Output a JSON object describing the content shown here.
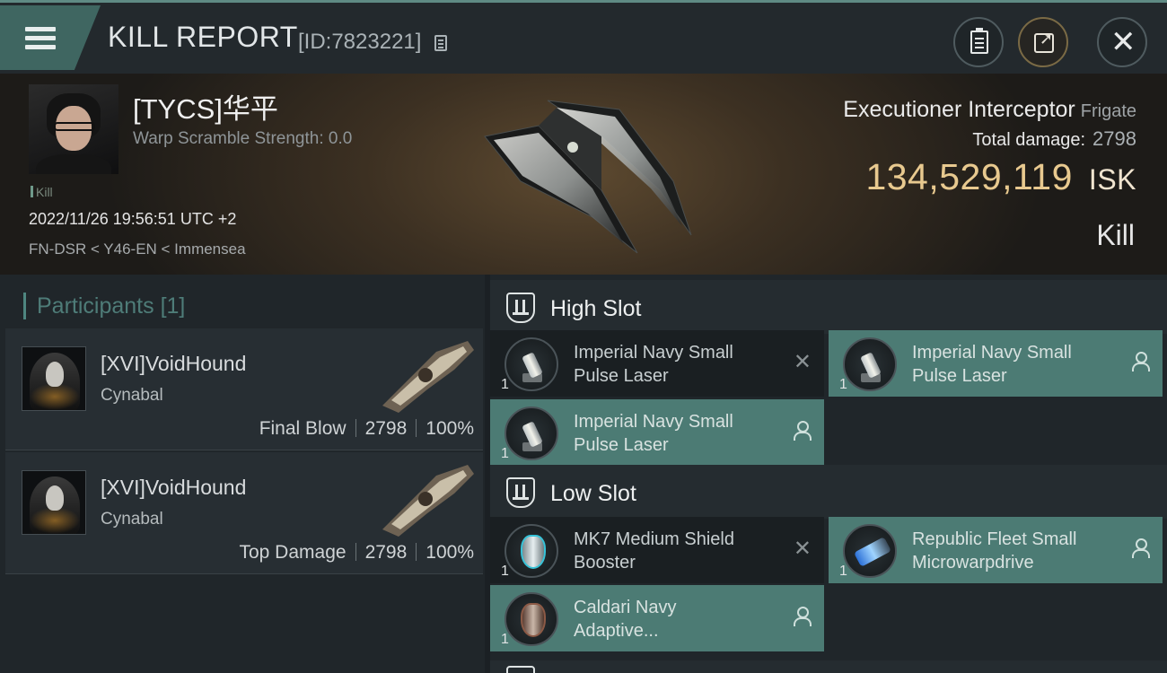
{
  "header": {
    "title": "KILL REPORT",
    "report_id": "[ID:7823221]",
    "icons": {
      "menu": "hamburger-menu-icon",
      "copy_id": "copy-icon",
      "clipboard": "clipboard-icon",
      "share": "share-icon",
      "close": "close-icon"
    }
  },
  "victim": {
    "name": "[TYCS]华平",
    "warp_scramble": "Warp Scramble Strength: 0.0",
    "kill_tag": "Kill",
    "time": "2022/11/26 19:56:51 UTC +2",
    "location": "FN-DSR < Y46-EN < Immensea",
    "ship_name": "Executioner Interceptor",
    "ship_class": "Frigate",
    "total_damage_label": "Total damage:",
    "total_damage": "2798",
    "isk_value": "134,529,119",
    "isk_unit": "ISK",
    "result": "Kill"
  },
  "participants": {
    "title": "Participants",
    "count": "[1]",
    "items": [
      {
        "name": "[XVI]VoidHound",
        "ship": "Cynabal",
        "role": "Final Blow",
        "damage": "2798",
        "percent": "100%"
      },
      {
        "name": "[XVI]VoidHound",
        "ship": "Cynabal",
        "role": "Top Damage",
        "damage": "2798",
        "percent": "100%"
      }
    ]
  },
  "fitting": {
    "high_slot": {
      "title": "High Slot",
      "modules": [
        {
          "name": "Imperial Navy Small Pulse Laser",
          "qty": "1",
          "state": "destroyed"
        },
        {
          "name": "Imperial Navy Small Pulse Laser",
          "qty": "1",
          "state": "dropped"
        },
        {
          "name": "Imperial Navy Small Pulse Laser",
          "qty": "1",
          "state": "dropped"
        }
      ]
    },
    "low_slot": {
      "title": "Low Slot",
      "modules": [
        {
          "name": "MK7 Medium Shield Booster",
          "qty": "1",
          "state": "destroyed"
        },
        {
          "name": "Republic Fleet Small Microwarpdrive",
          "qty": "1",
          "state": "dropped"
        },
        {
          "name": "Caldari Navy Adaptive...",
          "qty": "1",
          "state": "dropped"
        }
      ]
    }
  },
  "colors": {
    "accent_teal": "#4c7b74",
    "isk_gold": "#e8c98f",
    "panel_bg": "#20262a"
  }
}
